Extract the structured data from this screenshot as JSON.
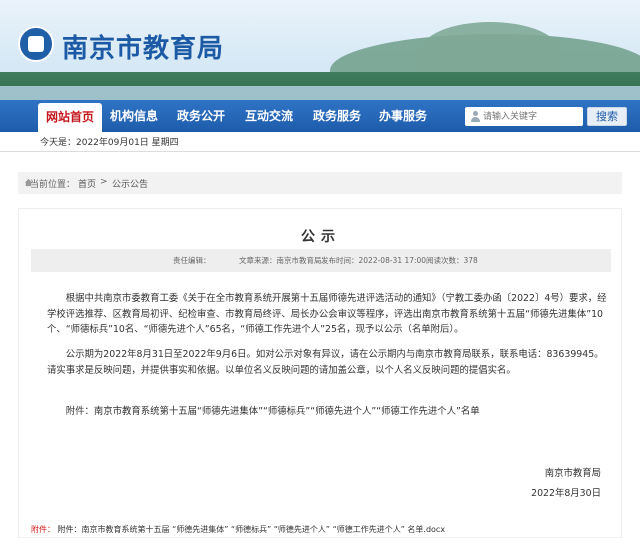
{
  "site": {
    "title": "南京市教育局"
  },
  "nav": {
    "items": [
      "网站首页",
      "机构信息",
      "政务公开",
      "互动交流",
      "政务服务",
      "办事服务"
    ],
    "search_placeholder": "请输入关键字",
    "search_button": "搜索"
  },
  "date_bar": {
    "text": "今天是：2022年09月01日 星期四"
  },
  "breadcrumb": {
    "prefix": "当前位置：",
    "home": "首页",
    "sep": ">",
    "current": "公示公告"
  },
  "article": {
    "title": "公示",
    "meta": {
      "editor": "责任编辑：",
      "source": "文章来源：南京市教育局",
      "date": "发布时间：2022-08-31 17:00",
      "views": "阅读次数：378"
    },
    "body": [
      "根据中共南京市委教育工委《关于在全市教育系统开展第十五届师德先进评选活动的通知》（宁教工委办函〔2022〕4号）要求，经学校评选推荐、区教育局初评、纪检审查、市教育局终评、局长办公会审议等程序，评选出南京市教育系统第十五届“师德先进集体”10个、“师德标兵”10名、“师德先进个人”65名，“师德工作先进个人”25名，现予以公示（名单附后）。",
      "公示期为2022年8月31日至2022年9月6日。如对公示对象有异议，请在公示期内与南京市教育局联系，联系电话：83639945。请实事求是反映问题，并提供事实和依据。以单位名义反映问题的请加盖公章，以个人名义反映问题的提倡实名。",
      "附件：南京市教育系统第十五届“师德先进集体”“师德标兵”“师德先进个人”“师德工作先进个人”名单"
    ],
    "signature": {
      "org": "南京市教育局",
      "date": "2022年8月30日"
    },
    "attachment": {
      "label": "附件：",
      "file": "附件：南京市教育系统第十五届 “师德先进集体” “师德标兵” “师德先进个人” “师德工作先进个人” 名单.docx"
    }
  }
}
